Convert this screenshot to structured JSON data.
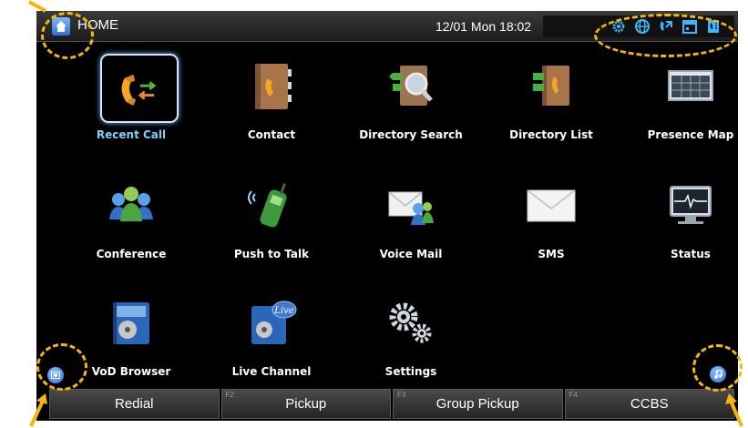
{
  "topbar": {
    "title": "HOME",
    "datetime": "12/01 Mon 18:02",
    "status_icons": [
      "gear-icon",
      "globe-icon",
      "call-forward-icon",
      "calendar-icon",
      "phone-book-icon"
    ]
  },
  "apps": [
    {
      "label": "Recent Call",
      "icon": "recent-call-icon",
      "selected": true
    },
    {
      "label": "Contact",
      "icon": "contact-book-icon"
    },
    {
      "label": "Directory Search",
      "icon": "directory-search-icon"
    },
    {
      "label": "Directory List",
      "icon": "directory-list-icon"
    },
    {
      "label": "Presence Map",
      "icon": "presence-map-icon"
    },
    {
      "label": "Conference",
      "icon": "conference-icon"
    },
    {
      "label": "Push to Talk",
      "icon": "push-to-talk-icon"
    },
    {
      "label": "Voice Mail",
      "icon": "voice-mail-icon"
    },
    {
      "label": "SMS",
      "icon": "sms-envelope-icon"
    },
    {
      "label": "Status",
      "icon": "status-monitor-icon"
    },
    {
      "label": "VoD Browser",
      "icon": "vod-film-icon"
    },
    {
      "label": "Live Channel",
      "icon": "live-channel-icon"
    },
    {
      "label": "Settings",
      "icon": "settings-gears-icon"
    }
  ],
  "fkeys": [
    {
      "num": "",
      "label": "Redial"
    },
    {
      "num": "F2",
      "label": "Pickup"
    },
    {
      "num": "F3",
      "label": "Group Pickup"
    },
    {
      "num": "F4",
      "label": "CCBS"
    }
  ],
  "annotation_color": "#f5b50f",
  "selected_color": "#7fd0ff"
}
